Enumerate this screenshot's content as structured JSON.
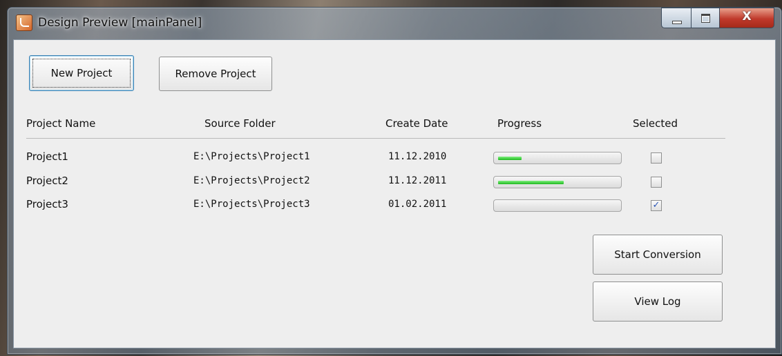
{
  "window": {
    "title": "Design Preview [mainPanel]",
    "close_glyph": "X",
    "icon": "java-icon"
  },
  "toolbar": {
    "new_project_label": "New Project",
    "remove_project_label": "Remove Project"
  },
  "table": {
    "columns": [
      "Project Name",
      "Source Folder",
      "Create Date",
      "Progress",
      "Selected"
    ],
    "rows": [
      {
        "name": "Project1",
        "folder": "E:\\Projects\\Project1",
        "date": "11.12.2010",
        "progress_fraction": 0.2,
        "selected": false
      },
      {
        "name": "Project2",
        "folder": "E:\\Projects\\Project2",
        "date": "11.12.2011",
        "progress_fraction": 0.55,
        "selected": false
      },
      {
        "name": "Project3",
        "folder": "E:\\Projects\\Project3",
        "date": "01.02.2011",
        "progress_fraction": 0.0,
        "selected": true
      }
    ]
  },
  "actions": {
    "start_conversion_label": "Start Conversion",
    "view_log_label": "View Log"
  },
  "colors": {
    "progress_fill": "#1fb81f",
    "checkbox_check": "#2a55b5",
    "focus_border": "#3c7fb1"
  }
}
